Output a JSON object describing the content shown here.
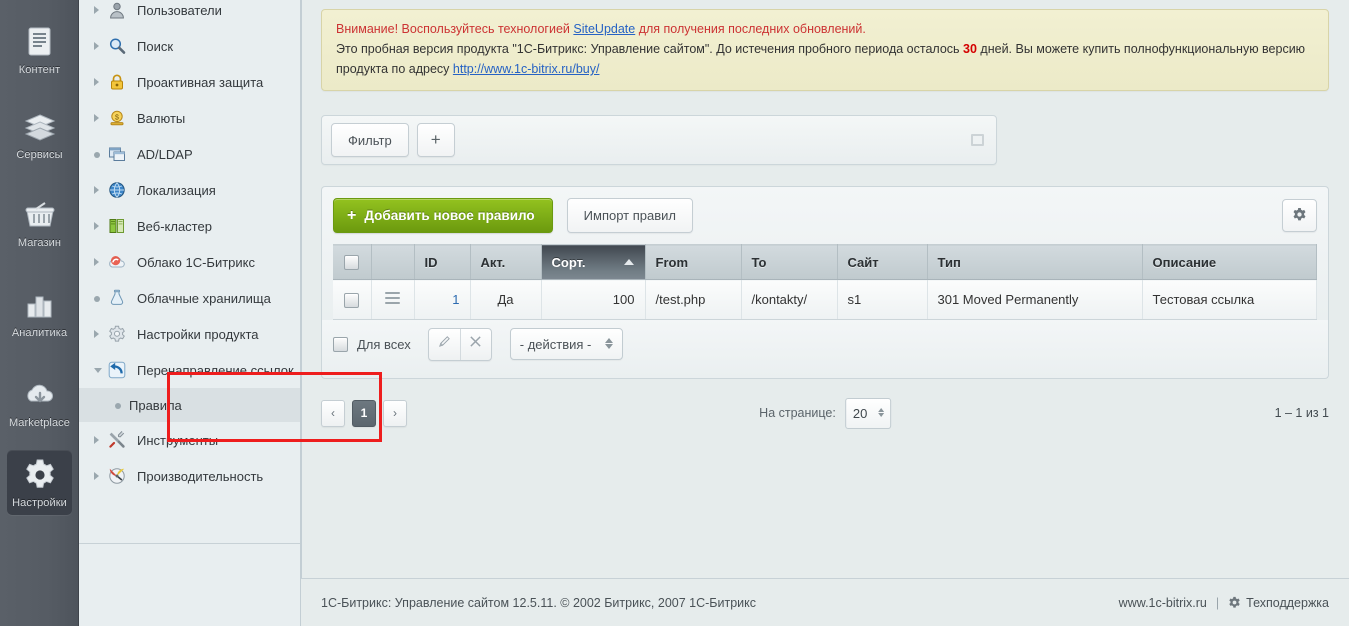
{
  "rail": {
    "items": [
      {
        "label": "Контент",
        "icon": "document-icon",
        "active": false
      },
      {
        "label": "Сервисы",
        "icon": "layers-icon",
        "active": false
      },
      {
        "label": "Магазин",
        "icon": "basket-icon",
        "active": false
      },
      {
        "label": "Аналитика",
        "icon": "bar-chart-icon",
        "active": false
      },
      {
        "label": "Marketplace",
        "icon": "cloud-download-icon",
        "active": false
      },
      {
        "label": "Настройки",
        "icon": "gear-icon",
        "active": true
      }
    ]
  },
  "sidebar": {
    "items": [
      {
        "label": "Пользователи",
        "icon": "user-icon",
        "marker": "arrow",
        "level": 0,
        "selected": false
      },
      {
        "label": "Поиск",
        "icon": "magnifier-icon",
        "marker": "arrow",
        "level": 0,
        "selected": false
      },
      {
        "label": "Проактивная защита",
        "icon": "lock-icon",
        "marker": "arrow",
        "level": 0,
        "selected": false
      },
      {
        "label": "Валюты",
        "icon": "currency-icon",
        "marker": "arrow",
        "level": 0,
        "selected": false
      },
      {
        "label": "AD/LDAP",
        "icon": "window-icon",
        "marker": "dot",
        "level": 0,
        "selected": false
      },
      {
        "label": "Локализация",
        "icon": "globe-icon",
        "marker": "arrow",
        "level": 0,
        "selected": false
      },
      {
        "label": "Веб-кластер",
        "icon": "server-icon",
        "marker": "arrow",
        "level": 0,
        "selected": false
      },
      {
        "label": "Облако 1С-Битрикс",
        "icon": "cloud-icon",
        "marker": "arrow",
        "level": 0,
        "selected": false
      },
      {
        "label": "Облачные хранилища",
        "icon": "storage-icon",
        "marker": "dot",
        "level": 0,
        "selected": false
      },
      {
        "label": "Настройки продукта",
        "icon": "gear-icon",
        "marker": "arrow",
        "level": 0,
        "selected": false
      },
      {
        "label": "Перенаправление ссылок",
        "icon": "redirect-icon",
        "marker": "arrow-open",
        "level": 0,
        "selected": false
      },
      {
        "label": "Правила",
        "icon": "none",
        "marker": "dot",
        "level": 1,
        "selected": true
      },
      {
        "label": "Инструменты",
        "icon": "tools-icon",
        "marker": "arrow",
        "level": 0,
        "selected": false
      },
      {
        "label": "Производительность",
        "icon": "gauge-icon",
        "marker": "arrow",
        "level": 0,
        "selected": false
      }
    ],
    "highlight_color": "#ee1d1d"
  },
  "notice": {
    "line1_pre": "Внимание! Воспользуйтесь технологией ",
    "line1_link": "SiteUpdate",
    "line1_post": " для получения последних обновлений.",
    "line2_a": "Это пробная версия продукта \"1С-Битрикс: Управление сайтом\". До истечения пробного периода осталось ",
    "line2_days": "30",
    "line2_b": " дней. Вы можете купить полнофункциональную версию продукта по адресу ",
    "line2_link": "http://www.1c-bitrix.ru/buy/"
  },
  "filter": {
    "button_label": "Фильтр",
    "add_label": "+"
  },
  "toolbar": {
    "add_rule_label": "Добавить новое правило",
    "add_rule_plus": "+",
    "import_label": "Импорт правил"
  },
  "grid": {
    "columns": [
      {
        "key": "checkbox",
        "label": ""
      },
      {
        "key": "drag",
        "label": ""
      },
      {
        "key": "id",
        "label": "ID"
      },
      {
        "key": "active",
        "label": "Акт."
      },
      {
        "key": "sort",
        "label": "Сорт.",
        "sorted": true,
        "sort_dir": "asc"
      },
      {
        "key": "from",
        "label": "From"
      },
      {
        "key": "to",
        "label": "To"
      },
      {
        "key": "site",
        "label": "Сайт"
      },
      {
        "key": "type",
        "label": "Тип"
      },
      {
        "key": "description",
        "label": "Описание"
      }
    ],
    "rows": [
      {
        "id": "1",
        "active": "Да",
        "sort": "100",
        "from": "/test.php",
        "to": "/kontakty/",
        "site": "s1",
        "type": "301 Moved Permanently",
        "description": "Тестовая ссылка"
      }
    ]
  },
  "actionbar": {
    "select_all_label": "Для всех",
    "edit_icon": "pencil-icon",
    "delete_icon": "close-icon",
    "actions_value": "- действия -"
  },
  "pagination": {
    "prev_label": "‹",
    "next_label": "›",
    "pages": [
      "1"
    ],
    "current_page": "1",
    "per_page_label": "На странице:",
    "per_page_value": "20",
    "total_label": "1 – 1 из 1"
  },
  "footer": {
    "copyright": "1С-Битрикс: Управление сайтом 12.5.11. © 2002 Битрикс, 2007 1С-Битрикс",
    "site_link": "www.1c-bitrix.ru",
    "separator": "|",
    "support_label": "Техподдержка"
  }
}
